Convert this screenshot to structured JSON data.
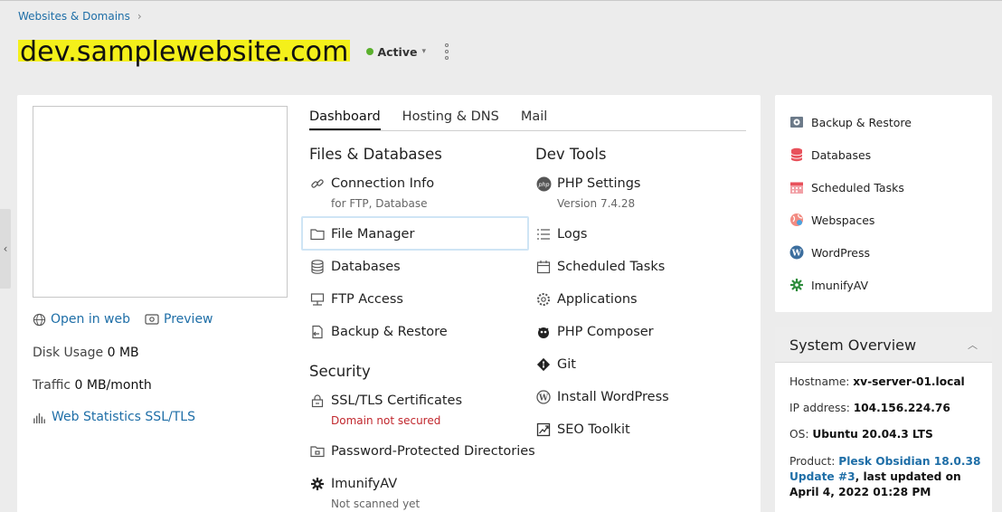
{
  "breadcrumb": {
    "label": "Websites & Domains"
  },
  "domain": {
    "title": "dev.samplewebsite.com",
    "status": "Active"
  },
  "preview_panel": {
    "open_in_web": "Open in web",
    "preview": "Preview",
    "disk_usage_label": "Disk Usage",
    "disk_usage_value": "0 MB",
    "traffic_label": "Traffic",
    "traffic_value": "0 MB/month",
    "web_stats": "Web Statistics SSL/TLS"
  },
  "tabs": [
    {
      "label": "Dashboard",
      "active": true
    },
    {
      "label": "Hosting & DNS",
      "active": false
    },
    {
      "label": "Mail",
      "active": false
    }
  ],
  "sections": {
    "files": {
      "title": "Files & Databases",
      "items": [
        {
          "label": "Connection Info",
          "sub": "for FTP, Database",
          "icon": "link-icon"
        },
        {
          "label": "File Manager",
          "icon": "folder-icon"
        },
        {
          "label": "Databases",
          "icon": "database-icon"
        },
        {
          "label": "FTP Access",
          "icon": "ftp-icon"
        },
        {
          "label": "Backup & Restore",
          "icon": "backup-icon"
        }
      ]
    },
    "security": {
      "title": "Security",
      "items": [
        {
          "label": "SSL/TLS Certificates",
          "sub": "Domain not secured",
          "icon": "certificate-icon"
        },
        {
          "label": "Password-Protected Directories",
          "icon": "protected-folder-icon"
        },
        {
          "label": "ImunifyAV",
          "sub": "Not scanned yet",
          "icon": "gear-icon"
        }
      ]
    },
    "devtools": {
      "title": "Dev Tools",
      "items": [
        {
          "label": "PHP Settings",
          "sub": "Version 7.4.28",
          "icon": "php-icon"
        },
        {
          "label": "Logs",
          "icon": "logs-icon"
        },
        {
          "label": "Scheduled Tasks",
          "icon": "calendar-icon"
        },
        {
          "label": "Applications",
          "icon": "applications-icon"
        },
        {
          "label": "PHP Composer",
          "icon": "composer-icon"
        },
        {
          "label": "Git",
          "icon": "git-icon"
        },
        {
          "label": "Install WordPress",
          "icon": "wordpress-icon"
        },
        {
          "label": "SEO Toolkit",
          "icon": "seo-icon"
        }
      ]
    }
  },
  "sidebar": {
    "items": [
      {
        "label": "Backup & Restore",
        "icon": "backup-icon"
      },
      {
        "label": "Databases",
        "icon": "database-icon"
      },
      {
        "label": "Scheduled Tasks",
        "icon": "calendar-icon"
      },
      {
        "label": "Webspaces",
        "icon": "webspaces-icon"
      },
      {
        "label": "WordPress",
        "icon": "wordpress-icon"
      },
      {
        "label": "ImunifyAV",
        "icon": "imunify-icon"
      }
    ]
  },
  "overview": {
    "title": "System Overview",
    "hostname_label": "Hostname:",
    "hostname": "xv-server-01.local",
    "ip_label": "IP address:",
    "ip": "104.156.224.76",
    "os_label": "OS:",
    "os": "Ubuntu 20.04.3 LTS",
    "product_label": "Product:",
    "product": "Plesk Obsidian 18.0.38 Update #3",
    "updated_text": ", last updated on April 4, 2022 01:28 PM"
  },
  "colors": {
    "link": "#1e6ea7",
    "active_dot": "#5bb02d",
    "error": "#c1272d",
    "highlight": "#f4f01a"
  }
}
